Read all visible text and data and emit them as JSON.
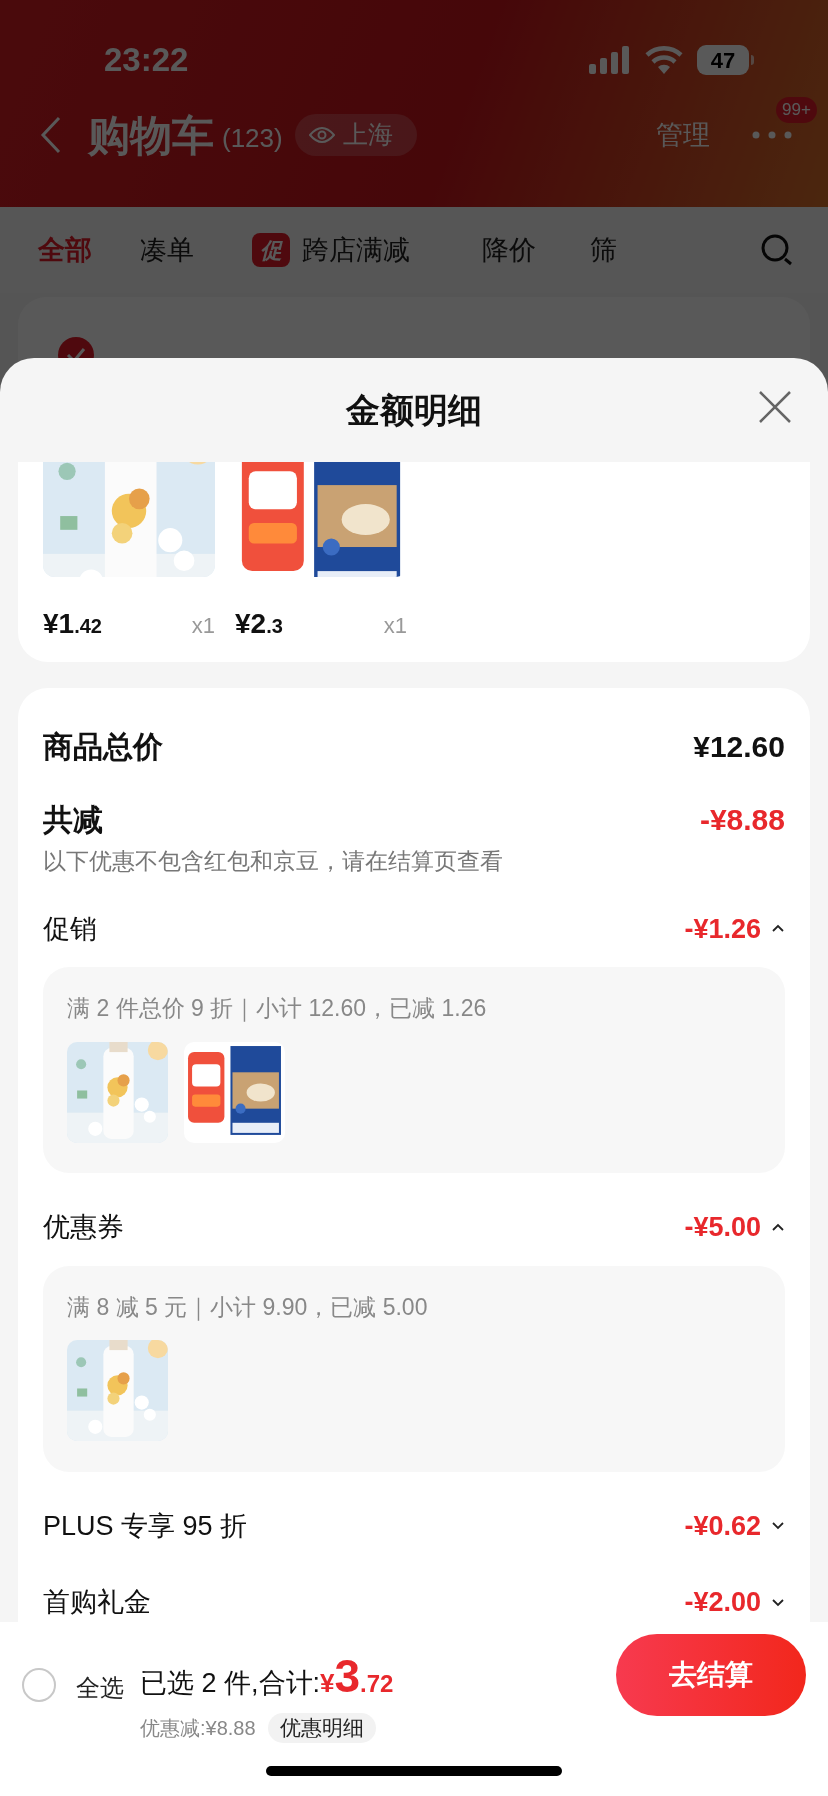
{
  "status_bar": {
    "time": "23:22",
    "battery": "47"
  },
  "header": {
    "title": "购物车",
    "count": "(123)",
    "location": "上海",
    "manage": "管理",
    "badge": "99+"
  },
  "tabs": [
    {
      "label": "全部",
      "selected": true
    },
    {
      "label": "凑单",
      "selected": false
    },
    {
      "label": "跨店满减",
      "badge": "促",
      "selected": false
    },
    {
      "label": "降价",
      "selected": false
    },
    {
      "label": "筛",
      "selected": false
    }
  ],
  "sheet": {
    "title": "金额明细",
    "products": [
      {
        "kind": "bottle",
        "price_main": "¥1",
        "price_fraction": ".42",
        "quantity": "x1"
      },
      {
        "kind": "salt",
        "price_main": "¥2",
        "price_fraction": ".3",
        "quantity": "x1"
      }
    ],
    "summary": {
      "total_label": "商品总价",
      "total_value": "¥12.60",
      "reduce_label": "共减",
      "reduce_value": "-¥8.88",
      "note": "以下优惠不包含红包和京豆，请在结算页查看"
    },
    "discounts": [
      {
        "label": "促销",
        "value": "-¥1.26",
        "expanded": true,
        "detail": "满 2 件总价 9 折｜小计 12.60，已减 1.26",
        "thumbnails": [
          {
            "kind": "bottle"
          },
          {
            "kind": "salt"
          }
        ]
      },
      {
        "label": "优惠券",
        "value": "-¥5.00",
        "expanded": true,
        "detail": "满 8 减 5 元｜小计 9.90，已减 5.00",
        "thumbnails": [
          {
            "kind": "bottle"
          }
        ]
      },
      {
        "label": "PLUS 专享 95 折",
        "value": "-¥0.62",
        "expanded": false
      },
      {
        "label": "首购礼金",
        "value": "-¥2.00",
        "expanded": false
      }
    ]
  },
  "footer": {
    "select_all": {
      "label": "全选",
      "checked": false
    },
    "selected_text": "已选 2 件,合计:",
    "currency": "¥",
    "total_main": "3",
    "total_fraction": ".72",
    "saved": "优惠减:¥8.88",
    "detail_button": "优惠明细",
    "checkout": "去结算"
  }
}
